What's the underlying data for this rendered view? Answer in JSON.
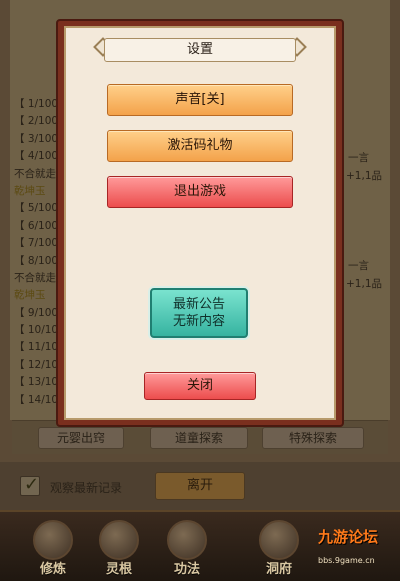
{
  "log": {
    "lines": [
      "【 1/100",
      "【 2/100",
      "【 3/100",
      "【 4/100",
      "不合就走",
      "乾坤玉",
      "【 5/100",
      "【 6/100",
      "【 7/100",
      "【 8/100",
      "不合就走",
      "乾坤玉",
      "【 9/100",
      "【 10/10",
      "【 11/10",
      "【 12/10",
      "【 13/10",
      "【 14/10"
    ],
    "right_1": "一言",
    "right_2": "+1,1品",
    "right_3": "一言",
    "right_4": "+1,1品"
  },
  "tabs": [
    "元婴出窍",
    "道童探索",
    "特殊探索"
  ],
  "bottom": {
    "checkbox_label": "观察最新记录",
    "leave_label": "离开"
  },
  "nav": [
    "修炼",
    "灵根",
    "功法",
    "洞府"
  ],
  "watermark": {
    "text": "九游论坛",
    "sub": "bbs.9game.cn"
  },
  "modal": {
    "title": "设置",
    "sound_button": "声音[关]",
    "gift_code_button": "激活码礼物",
    "quit_button": "退出游戏",
    "notice_line1": "最新公告",
    "notice_line2": "无新内容",
    "close_button": "关闭"
  }
}
